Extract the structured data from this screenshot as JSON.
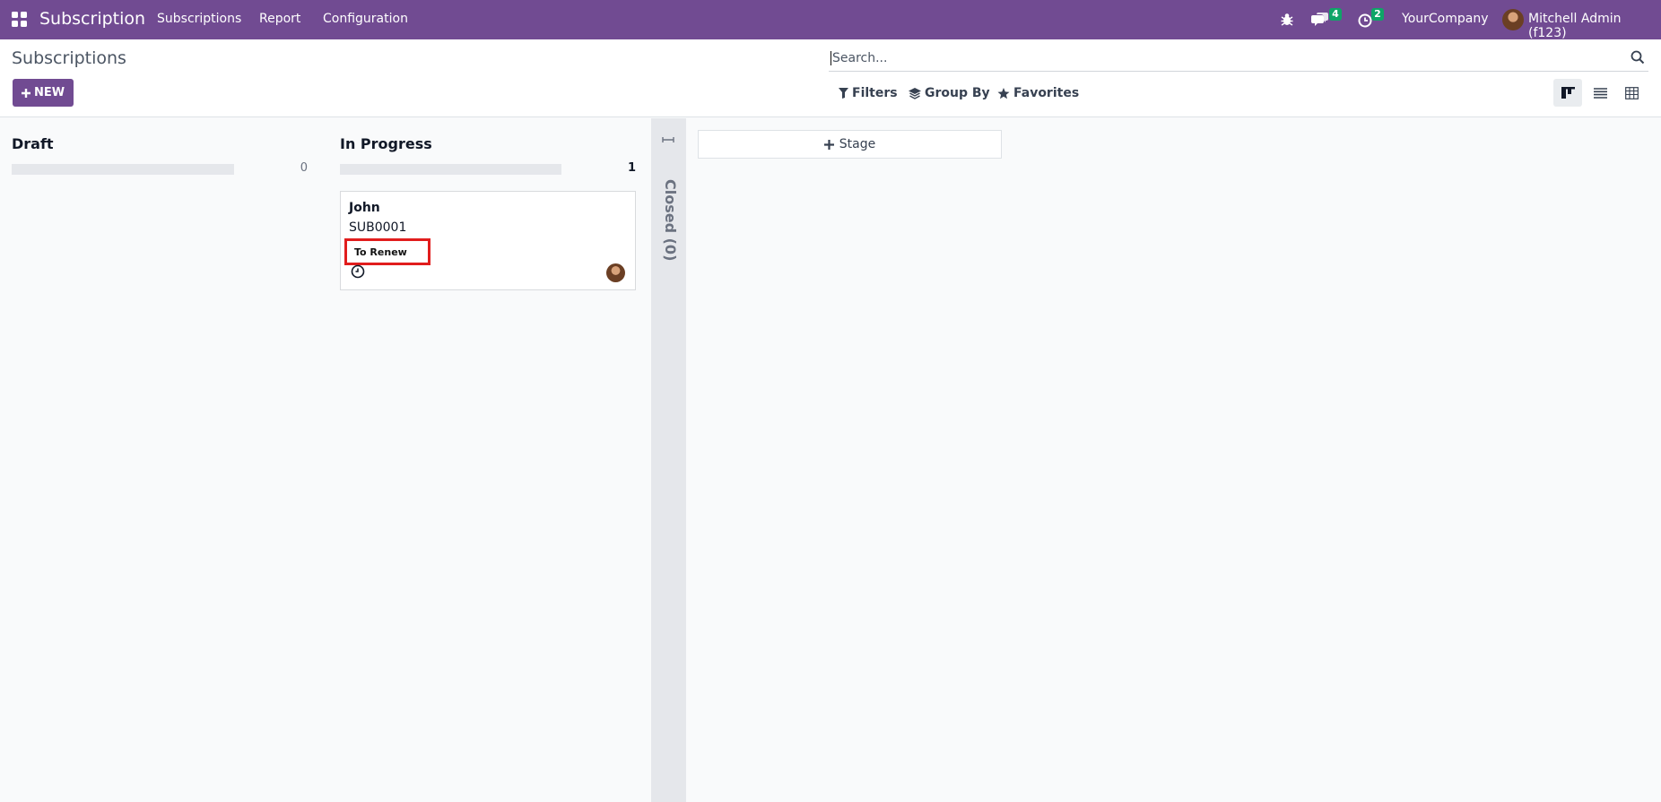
{
  "navbar": {
    "app_title": "Subscription",
    "menus": [
      "Subscriptions",
      "Report",
      "Configuration"
    ],
    "messages_badge": "4",
    "activities_badge": "2",
    "company": "YourCompany",
    "user": "Mitchell Admin (f123)",
    "icons": [
      "apps-icon",
      "bug-icon",
      "chat-icon",
      "clock-icon"
    ]
  },
  "control_panel": {
    "breadcrumb": "Subscriptions",
    "new_label": "NEW",
    "search_placeholder": "Search...",
    "filters_label": "Filters",
    "group_by_label": "Group By",
    "favorites_label": "Favorites",
    "active_view": "kanban"
  },
  "kanban": {
    "columns": [
      {
        "title": "Draft",
        "count": "0"
      },
      {
        "title": "In Progress",
        "count": "1",
        "cards": [
          {
            "name": "John",
            "reference": "SUB0001",
            "tag": "To Renew"
          }
        ]
      }
    ],
    "folded_column": {
      "label": "Closed (0)"
    },
    "add_stage_label": "Stage"
  },
  "colors": {
    "brand": "#714b92",
    "badge": "#0ea567",
    "highlight": "#e11d1d"
  }
}
